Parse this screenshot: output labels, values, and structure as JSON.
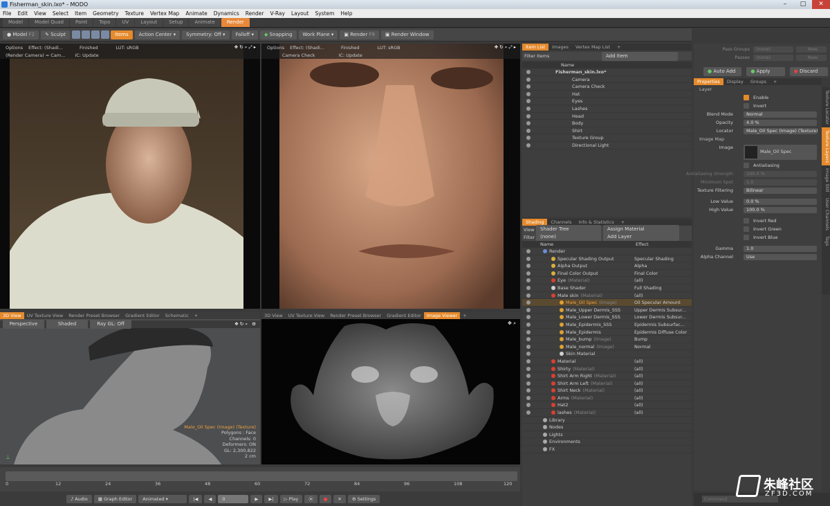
{
  "window": {
    "title": "Fisherman_skin.lxo* - MODO"
  },
  "menu": [
    "File",
    "Edit",
    "View",
    "Select",
    "Item",
    "Geometry",
    "Texture",
    "Vertex Map",
    "Animate",
    "Dynamics",
    "Render",
    "V-Ray",
    "Layout",
    "System",
    "Help"
  ],
  "layout_tabs": [
    {
      "label": "Model",
      "active": false
    },
    {
      "label": "Model Quad",
      "active": false
    },
    {
      "label": "Paint",
      "active": false
    },
    {
      "label": "Topo",
      "active": false
    },
    {
      "label": "UV",
      "active": false
    },
    {
      "label": "Layout",
      "active": false
    },
    {
      "label": "Setup",
      "active": false
    },
    {
      "label": "Animate",
      "active": false
    },
    {
      "label": "Render",
      "active": true
    }
  ],
  "toolbar": {
    "model": "Model",
    "f2": "F2",
    "sculpt": "Sculpt",
    "items": "Items",
    "action_center": "Action Center",
    "symmetry": "Symmetry: Off",
    "falloff": "Falloff",
    "snapping": "Snapping",
    "work_plane": "Work Plane",
    "render": "Render",
    "f9": "F9",
    "render_window": "Render Window"
  },
  "pass_groups": {
    "label": "Pass Groups",
    "value": "(none)",
    "new": "New",
    "passes_label": "Passes",
    "passes_value": "(none)",
    "passes_new": "New"
  },
  "actions": {
    "auto_add": "Auto Add",
    "apply": "Apply",
    "discard": "Discard"
  },
  "render_vp1": {
    "options": "Options",
    "effect": "Effect: (Shadi...",
    "status": "Finished",
    "lut": "LUT: sRGB",
    "camera": "(Render Camera) = Cam...",
    "ic": "IC: Update"
  },
  "render_vp2": {
    "options": "Options",
    "effect": "Effect: (Shadi...",
    "status": "Finished",
    "lut": "LUT: sRGB",
    "camera": "Camera Check",
    "ic": "IC: Update"
  },
  "vp3": {
    "tabs": [
      {
        "label": "3D View",
        "active": true
      },
      {
        "label": "UV Texture View",
        "active": false
      },
      {
        "label": "Render Preset Browser",
        "active": false
      },
      {
        "label": "Gradient Editor",
        "active": false
      },
      {
        "label": "Schematic",
        "active": false
      },
      {
        "label": "+",
        "active": false
      }
    ],
    "perspective": "Perspective",
    "shaded": "Shaded",
    "raygl": "Ray GL: Off",
    "info": [
      "Male_Oil Spec (Image) (Texture)",
      "Polygons : Face",
      "Channels: 0",
      "Deformers: ON",
      "GL: 2,300,822",
      "2 cm"
    ]
  },
  "vp4": {
    "tabs": [
      {
        "label": "3D View",
        "active": false
      },
      {
        "label": "UV Texture View",
        "active": false
      },
      {
        "label": "Render Preset Browser",
        "active": false
      },
      {
        "label": "Gradient Editor",
        "active": false
      },
      {
        "label": "Image Viewer",
        "active": true
      },
      {
        "label": "+",
        "active": false
      }
    ]
  },
  "item_list": {
    "tabs": [
      {
        "label": "Item List",
        "active": true
      },
      {
        "label": "Images",
        "active": false
      },
      {
        "label": "Vertex Map List",
        "active": false
      },
      {
        "label": "+",
        "active": false
      }
    ],
    "filter": "Filter Items",
    "add": "Add Item",
    "col": "Name",
    "items": [
      {
        "name": "Fisherman_skin.lxo*",
        "indent": 0,
        "bold": true
      },
      {
        "name": "Camera",
        "indent": 2
      },
      {
        "name": "Camera Check",
        "indent": 2
      },
      {
        "name": "Hat",
        "indent": 2
      },
      {
        "name": "Eyes",
        "indent": 2
      },
      {
        "name": "Lashes",
        "indent": 2
      },
      {
        "name": "Head",
        "indent": 2
      },
      {
        "name": "Body",
        "indent": 2
      },
      {
        "name": "Shirt",
        "indent": 2
      },
      {
        "name": "Texture Group",
        "indent": 2
      },
      {
        "name": "Directional Light",
        "indent": 2
      }
    ]
  },
  "shading": {
    "tabs": [
      {
        "label": "Shading",
        "active": true
      },
      {
        "label": "Channels",
        "active": false
      },
      {
        "label": "Info & Statistics",
        "active": false
      },
      {
        "label": "+",
        "active": false
      }
    ],
    "view_label": "View",
    "view": "Shader Tree",
    "assign": "Assign Material",
    "filter_label": "Filter",
    "filter": "(none)",
    "add_layer": "Add Layer",
    "col_name": "Name",
    "col_effect": "Effect",
    "rows": [
      {
        "name": "Render",
        "tag": "",
        "effect": "",
        "indent": 0,
        "color": "#6a8ed8"
      },
      {
        "name": "Specular Shading Output",
        "tag": "",
        "effect": "Specular Shading",
        "indent": 1,
        "color": "#d8b040"
      },
      {
        "name": "Alpha Output",
        "tag": "",
        "effect": "Alpha",
        "indent": 1,
        "color": "#d8b040"
      },
      {
        "name": "Final Color Output",
        "tag": "",
        "effect": "Final Color",
        "indent": 1,
        "color": "#d8b040"
      },
      {
        "name": "Eye",
        "tag": "(Material)",
        "effect": "(all)",
        "indent": 1,
        "color": "#d84030"
      },
      {
        "name": "Base Shader",
        "tag": "",
        "effect": "Full Shading",
        "indent": 1,
        "color": "#d0d0d0"
      },
      {
        "name": "Male skin",
        "tag": "(Material)",
        "effect": "(all)",
        "indent": 1,
        "color": "#d84030"
      },
      {
        "name": "Male_Oil Spec",
        "tag": "(Image)",
        "effect": "Oil Specular Amount",
        "indent": 2,
        "color": "#e0a030",
        "sel": true
      },
      {
        "name": "Male_Upper Dermis_SSS",
        "tag": "",
        "effect": "Upper Dermis Subsur...",
        "indent": 2,
        "color": "#e0a030"
      },
      {
        "name": "Male_Lower Dermis_SSS",
        "tag": "",
        "effect": "Lower Dermis Subsur...",
        "indent": 2,
        "color": "#e0a030"
      },
      {
        "name": "Male_Epidermis_SSS",
        "tag": "",
        "effect": "Epidermis Subsurfac...",
        "indent": 2,
        "color": "#e0a030"
      },
      {
        "name": "Male_Epidermis",
        "tag": "",
        "effect": "Epidermis Diffuse Color",
        "indent": 2,
        "color": "#e0a030"
      },
      {
        "name": "Male_bump",
        "tag": "(Image)",
        "effect": "Bump",
        "indent": 2,
        "color": "#e0a030"
      },
      {
        "name": "Male_normal",
        "tag": "(Image)",
        "effect": "Normal",
        "indent": 2,
        "color": "#e0a030"
      },
      {
        "name": "Skin Material",
        "tag": "",
        "effect": "",
        "indent": 2,
        "color": "#d0d0d0"
      },
      {
        "name": "Material",
        "tag": "",
        "effect": "(all)",
        "indent": 1,
        "color": "#d84030"
      },
      {
        "name": "Shirty",
        "tag": "(Material)",
        "effect": "(all)",
        "indent": 1,
        "color": "#d84030"
      },
      {
        "name": "Shirt Arm Right",
        "tag": "(Material)",
        "effect": "(all)",
        "indent": 1,
        "color": "#d84030"
      },
      {
        "name": "Shirt Arm Left",
        "tag": "(Material)",
        "effect": "(all)",
        "indent": 1,
        "color": "#d84030"
      },
      {
        "name": "Shirt Neck",
        "tag": "(Material)",
        "effect": "(all)",
        "indent": 1,
        "color": "#d84030"
      },
      {
        "name": "Arms",
        "tag": "(Material)",
        "effect": "(all)",
        "indent": 1,
        "color": "#d84030"
      },
      {
        "name": "Hat2",
        "tag": "",
        "effect": "(all)",
        "indent": 1,
        "color": "#d84030"
      },
      {
        "name": "lashes",
        "tag": "(Material)",
        "effect": "(all)",
        "indent": 1,
        "color": "#d84030"
      },
      {
        "name": "Library",
        "tag": "",
        "effect": "",
        "indent": 0,
        "color": "#aaa"
      },
      {
        "name": "Nodes",
        "tag": "",
        "effect": "",
        "indent": 0,
        "color": "#aaa"
      },
      {
        "name": "Lights",
        "tag": "",
        "effect": "",
        "indent": 0,
        "color": "#aaa"
      },
      {
        "name": "Environments",
        "tag": "",
        "effect": "",
        "indent": 0,
        "color": "#aaa"
      },
      {
        "name": "FX",
        "tag": "",
        "effect": "",
        "indent": 0,
        "color": "#aaa"
      }
    ]
  },
  "properties": {
    "tabs": [
      {
        "label": "Properties",
        "active": true
      },
      {
        "label": "Display",
        "active": false
      },
      {
        "label": "Groups",
        "active": false
      },
      {
        "label": "+",
        "active": false
      }
    ],
    "side_tabs": [
      "Texture Locator",
      "Texture Layers",
      "Image Still",
      "User Channels",
      "Tags"
    ],
    "layer_section": "Layer",
    "enable": "Enable",
    "invert": "Invert",
    "blend_mode_label": "Blend Mode",
    "blend_mode": "Normal",
    "opacity_label": "Opacity",
    "opacity": "4.0 %",
    "locator_label": "Locator",
    "locator": "Male_Oil Spec (Image) (Texture)",
    "image_map_section": "Image Map",
    "image_label": "Image",
    "image": "Male_Oil Spec",
    "antialiasing": "Antialiasing",
    "aa_strength_label": "Antialiasing Strength",
    "aa_strength": "100.0 %",
    "min_spot_label": "Minimum Spot",
    "min_spot": "1.0",
    "tex_filter_label": "Texture Filtering",
    "tex_filter": "Bilinear",
    "low_label": "Low Value",
    "low": "0.0 %",
    "high_label": "High Value",
    "high": "100.0 %",
    "invert_red": "Invert Red",
    "invert_green": "Invert Green",
    "invert_blue": "Invert Blue",
    "gamma_label": "Gamma",
    "gamma": "1.0",
    "alpha_label": "Alpha Channel",
    "alpha": "Use"
  },
  "timeline": {
    "ticks": [
      "0",
      "12",
      "24",
      "36",
      "48",
      "60",
      "72",
      "84",
      "96",
      "108",
      "120"
    ],
    "bottom": [
      "0",
      "120",
      "120"
    ]
  },
  "bottom": {
    "audio": "Audio",
    "graph": "Graph Editor",
    "animated": "Animated",
    "frame": "0",
    "play": "Play",
    "settings": "Settings"
  },
  "command": {
    "placeholder": "Command"
  },
  "watermark": {
    "cn": "朱峰社区",
    "url": "ZF3D.COM"
  }
}
